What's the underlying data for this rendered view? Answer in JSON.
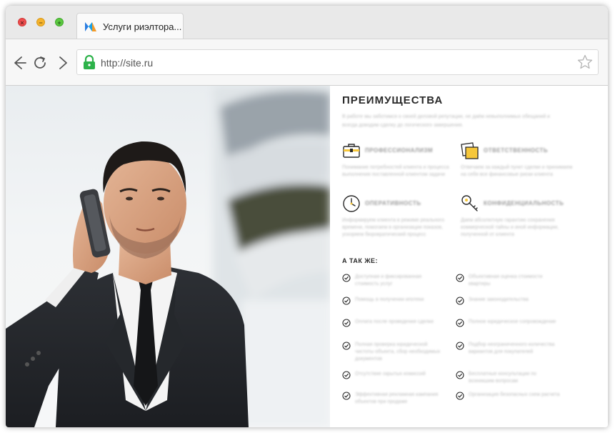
{
  "window": {
    "controls": {
      "close": "×",
      "minimize": "−",
      "maximize": "+"
    },
    "tab": {
      "title": "Услуги риэлтора..."
    },
    "address": {
      "url": "http://site.ru"
    }
  },
  "colors": {
    "accent_yellow": "#f6c73b",
    "lock_green": "#2db24a",
    "text_dark": "#2a2a2a"
  },
  "panel": {
    "title": "ПРЕИМУЩЕСТВА",
    "intro": "В работе мы заботимся о своей деловой репутации, не даём невыполнимых обещаний и всегда доводим сделку до логического завершения.",
    "features": [
      {
        "icon": "briefcase-icon",
        "title": "ПРОФЕССИОНАЛИЗМ",
        "text": "Понимание потребностей клиента и процесса выполнения поставленной клиентом задачи"
      },
      {
        "icon": "sticky-note-icon",
        "title": "ОТВЕТСТВЕННОСТЬ",
        "text": "Отвечаем за каждый пункт сделки и принимаем на себя все финансовые риски клиента"
      },
      {
        "icon": "clock-icon",
        "title": "ОПЕРАТИВНОСТЬ",
        "text": "Информируем клиента в режиме реального времени, помогаем в организации показов, ускоряем бюрократический процесс"
      },
      {
        "icon": "key-icon",
        "title": "КОНФИДЕНЦИАЛЬНОСТЬ",
        "text": "Даем абсолютную гарантию сохранения коммерческой тайны и иной информации, полученной от клиента"
      }
    ],
    "also_title": "А ТАК ЖЕ:",
    "also_items": [
      "Доступная и фиксированная стоимость услуг",
      "Объективная оценка стоимости квартиры",
      "Помощь в получении ипотеки",
      "Знание законодательства",
      "Оплата после проведения сделки",
      "Полное юридическое сопровождение",
      "Полная проверка юридической чистоты объекта, сбор необходимых документов",
      "Подбор неограниченного количества вариантов для покупателей",
      "Отсутствие скрытых комиссий",
      "Бесплатные консультации по возникшим вопросам",
      "Эффективная рекламная кампания объектов при продаже",
      "Организация безопасных схем расчета"
    ]
  }
}
